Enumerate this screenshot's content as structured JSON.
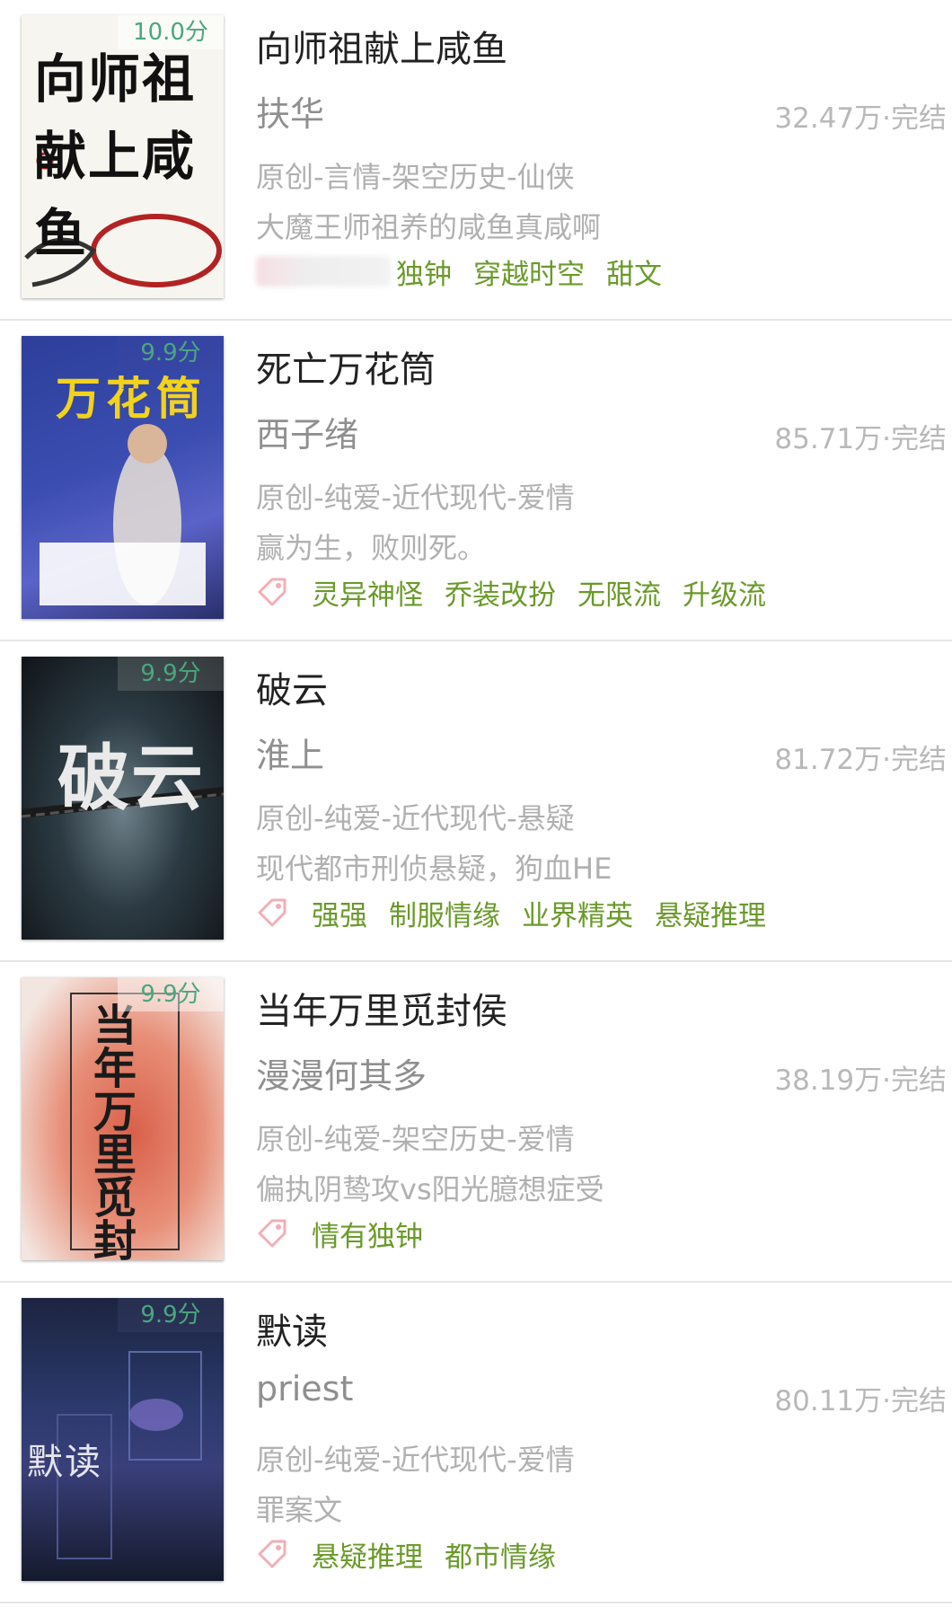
{
  "books": [
    {
      "title": "向师祖献上咸鱼",
      "author": "扶华",
      "stats": "32.47万·完结",
      "genre": "原创-言情-架空历史-仙侠",
      "desc": "大魔王师祖养的咸鱼真咸啊",
      "score": "10.0分",
      "cover_text": "向师祖献上咸鱼",
      "tags": [
        "独钟",
        "穿越时空",
        "甜文"
      ]
    },
    {
      "title": "死亡万花筒",
      "author": "西子绪",
      "stats": "85.71万·完结",
      "genre": "原创-纯爱-近代现代-爱情",
      "desc": "赢为生，败则死。",
      "score": "9.9分",
      "cover_text": "万花筒",
      "tags": [
        "灵异神怪",
        "乔装改扮",
        "无限流",
        "升级流"
      ]
    },
    {
      "title": "破云",
      "author": "淮上",
      "stats": "81.72万·完结",
      "genre": "原创-纯爱-近代现代-悬疑",
      "desc": "现代都市刑侦悬疑，狗血HE",
      "score": "9.9分",
      "cover_text": "破云",
      "tags": [
        "强强",
        "制服情缘",
        "业界精英",
        "悬疑推理"
      ]
    },
    {
      "title": "当年万里觅封侯",
      "author": "漫漫何其多",
      "stats": "38.19万·完结",
      "genre": "原创-纯爱-架空历史-爱情",
      "desc": "偏执阴鸷攻vs阳光臆想症受",
      "score": "9.9分",
      "cover_text": "当年万里觅封侯",
      "tags": [
        "情有独钟"
      ]
    },
    {
      "title": "默读",
      "author": "priest",
      "stats": "80.11万·完结",
      "genre": "原创-纯爱-近代现代-爱情",
      "desc": "罪案文",
      "score": "9.9分",
      "cover_text": "默读",
      "tags": [
        "悬疑推理",
        "都市情缘"
      ]
    }
  ]
}
